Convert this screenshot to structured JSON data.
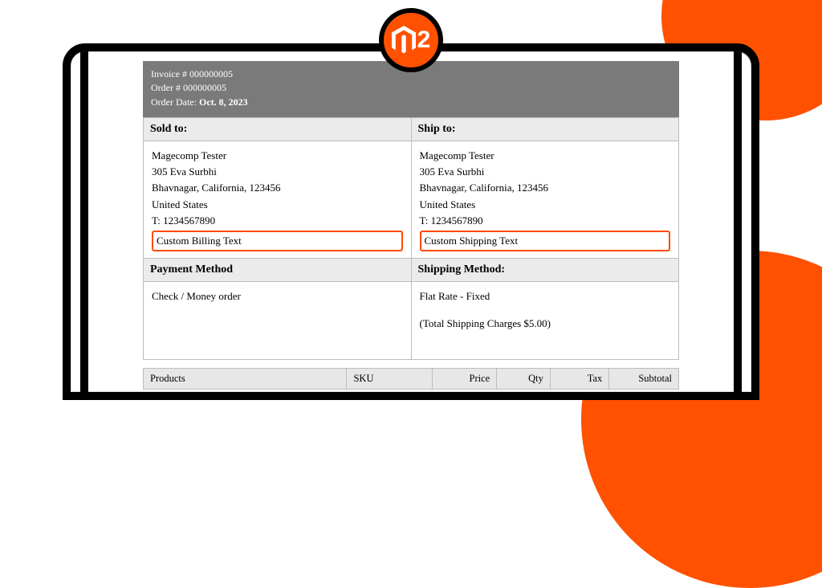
{
  "badge": {
    "suffix": "2"
  },
  "header": {
    "invoice_label": "Invoice # ",
    "invoice_no": "000000005",
    "order_label": "Order # ",
    "order_no": "000000005",
    "date_label": "Order Date: ",
    "date_value": "Oct. 8, 2023"
  },
  "addr_headers": {
    "sold": "Sold to:",
    "ship": "Ship to:"
  },
  "sold": {
    "name": "Magecomp Tester",
    "street": "305 Eva Surbhi",
    "city": "Bhavnagar, California, 123456",
    "country": "United States",
    "phone": "T: 1234567890",
    "custom": "Custom Billing Text"
  },
  "ship": {
    "name": "Magecomp Tester",
    "street": "305 Eva Surbhi",
    "city": "Bhavnagar, California, 123456",
    "country": "United States",
    "phone": "T: 1234567890",
    "custom": "Custom Shipping Text"
  },
  "method_headers": {
    "payment": "Payment Method",
    "shipping": "Shipping Method:"
  },
  "payment": {
    "value": "Check / Money order"
  },
  "shipping": {
    "rate": "Flat Rate - Fixed",
    "charges": "(Total Shipping Charges $5.00)"
  },
  "items_headers": {
    "products": "Products",
    "sku": "SKU",
    "price": "Price",
    "qty": "Qty",
    "tax": "Tax",
    "subtotal": "Subtotal"
  }
}
